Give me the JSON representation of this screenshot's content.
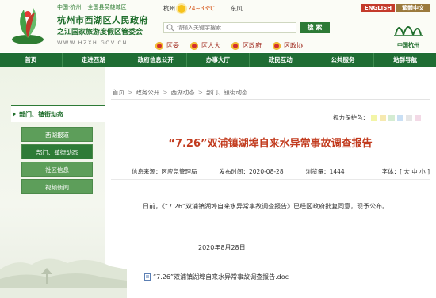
{
  "header": {
    "small_links": [
      "中国·杭州",
      "全国县英雄城区"
    ],
    "title": "杭州市西湖区人民政府",
    "subtitle": "之江国家旅游度假区管委会",
    "url": "WWW.HZXH.GOV.CN",
    "weather": {
      "city": "杭州",
      "temp": "24~33℃",
      "wind": "东风"
    },
    "lang_en": "ENGLISH",
    "lang_tw": "繁體中文",
    "search": {
      "placeholder": "请输入关键字搜索",
      "button": "搜 索"
    },
    "orgs": [
      "区委",
      "区人大",
      "区政府",
      "区政协"
    ],
    "city_logo_text": "中国杭州"
  },
  "nav": [
    "首页",
    "走进西湖",
    "政府信息公开",
    "办事大厅",
    "政民互动",
    "公共服务",
    "站群导航"
  ],
  "sidebar": {
    "heading": "部门、镇街动态",
    "items": [
      "西湖报道",
      "部门、镇街动态",
      "社区信息",
      "视频新闻"
    ],
    "active_index": 1
  },
  "breadcrumb": [
    "首页",
    "政务公开",
    "西湖动态",
    "部门、镇街动态"
  ],
  "eye_protection": {
    "label": "视力保护色：",
    "colors": [
      "#f3f5a7",
      "#f6e9b0",
      "#d4ecd3",
      "#c9dff4",
      "#e6e6e6",
      "#f3d9e6"
    ]
  },
  "article": {
    "title": "“7.26”双浦镇湖埠自来水异常事故调查报告",
    "source": "信息来源：区应急管理局",
    "date": "发布时间：2020-08-28",
    "views": "浏览量：1444",
    "font_size": "字体：[ 大 中 小 ]",
    "body": "日前，《“7.26”双浦镇湖埠自来水异常事故调查报告》已经区政府批复同意，现予公布。",
    "sign_date": "2020年8月28日",
    "attachment": "“7.26”双浦镇湖埠自来水异常事故调查报告.doc"
  },
  "colors": {
    "brand_green": "#1f6d34",
    "title_red": "#c23b1e"
  }
}
